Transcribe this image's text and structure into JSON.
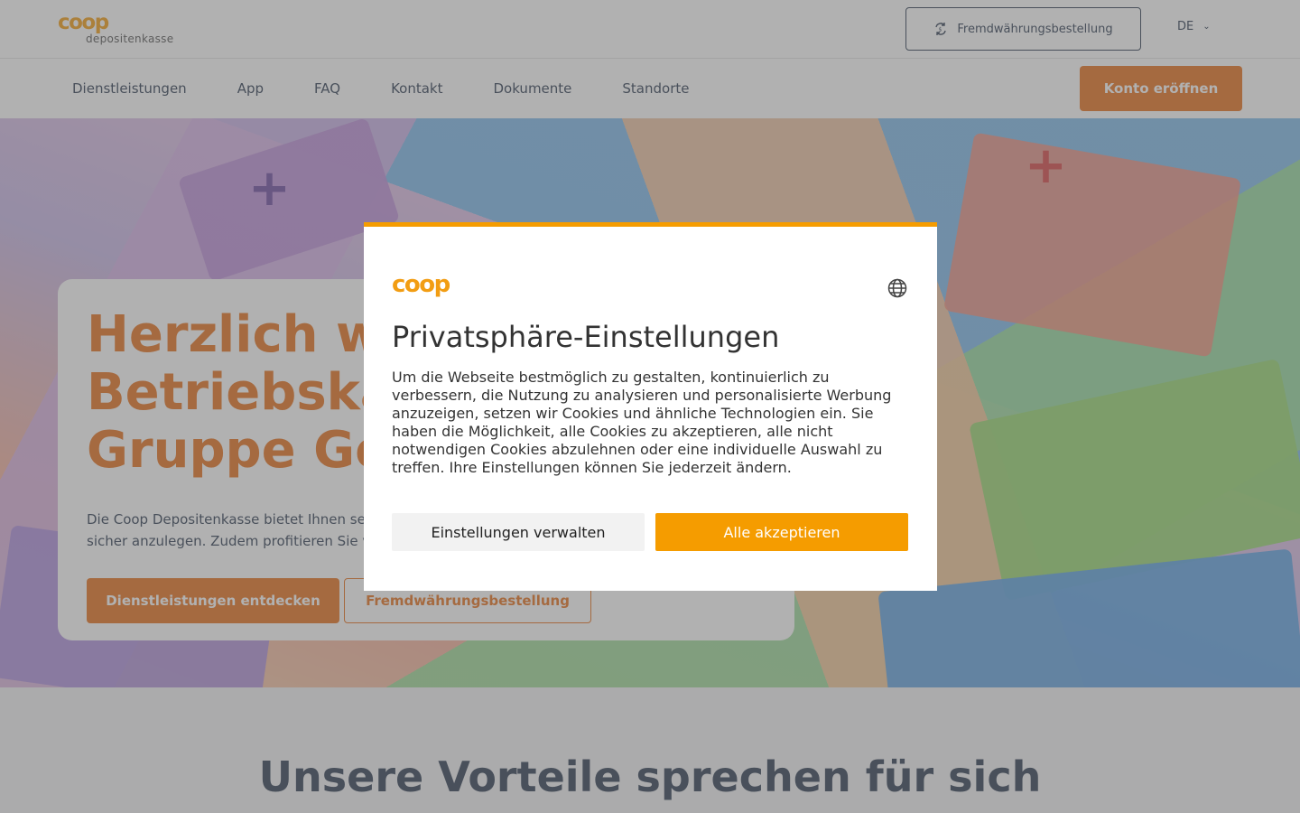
{
  "header": {
    "logo_word": "coop",
    "logo_sub": "depositenkasse",
    "fx_button": "Fremdwährungsbestellung",
    "language": "DE"
  },
  "nav": {
    "items": [
      "Dienstleistungen",
      "App",
      "FAQ",
      "Kontakt",
      "Dokumente",
      "Standorte"
    ],
    "cta": "Konto eröffnen"
  },
  "hero": {
    "title_lines": [
      "Herzlich will",
      "Betriebskass",
      "Gruppe Gene"
    ],
    "text_lines": [
      "Die Coop Depositenkasse bietet Ihnen sei",
      "sicher anzulegen. Zudem profitieren Sie v"
    ],
    "button_primary": "Dienstleistungen entdecken",
    "button_secondary": "Fremdwährungsbestellung"
  },
  "section": {
    "title": "Unsere Vorteile sprechen für sich"
  },
  "consent": {
    "logo_word": "coop",
    "title": "Privatsphäre-Einstellungen",
    "text": "Um die Webseite bestmöglich zu gestalten, kontinuierlich zu verbessern, die Nutzung zu analysieren und personalisierte Werbung anzuzeigen, setzen wir Cookies und ähnliche Technologien ein. Sie haben die Möglichkeit, alle Cookies zu akzeptieren, alle nicht notwendigen Cookies abzulehnen oder eine individuelle Auswahl zu treffen. Ihre Einstellungen können Sie jederzeit ändern.",
    "button_settings": "Einstellungen verwalten",
    "button_accept": "Alle akzeptieren",
    "accent_color": "#f59c00"
  },
  "colors": {
    "brand_orange": "#e7701c",
    "navy": "#2f3d52"
  }
}
